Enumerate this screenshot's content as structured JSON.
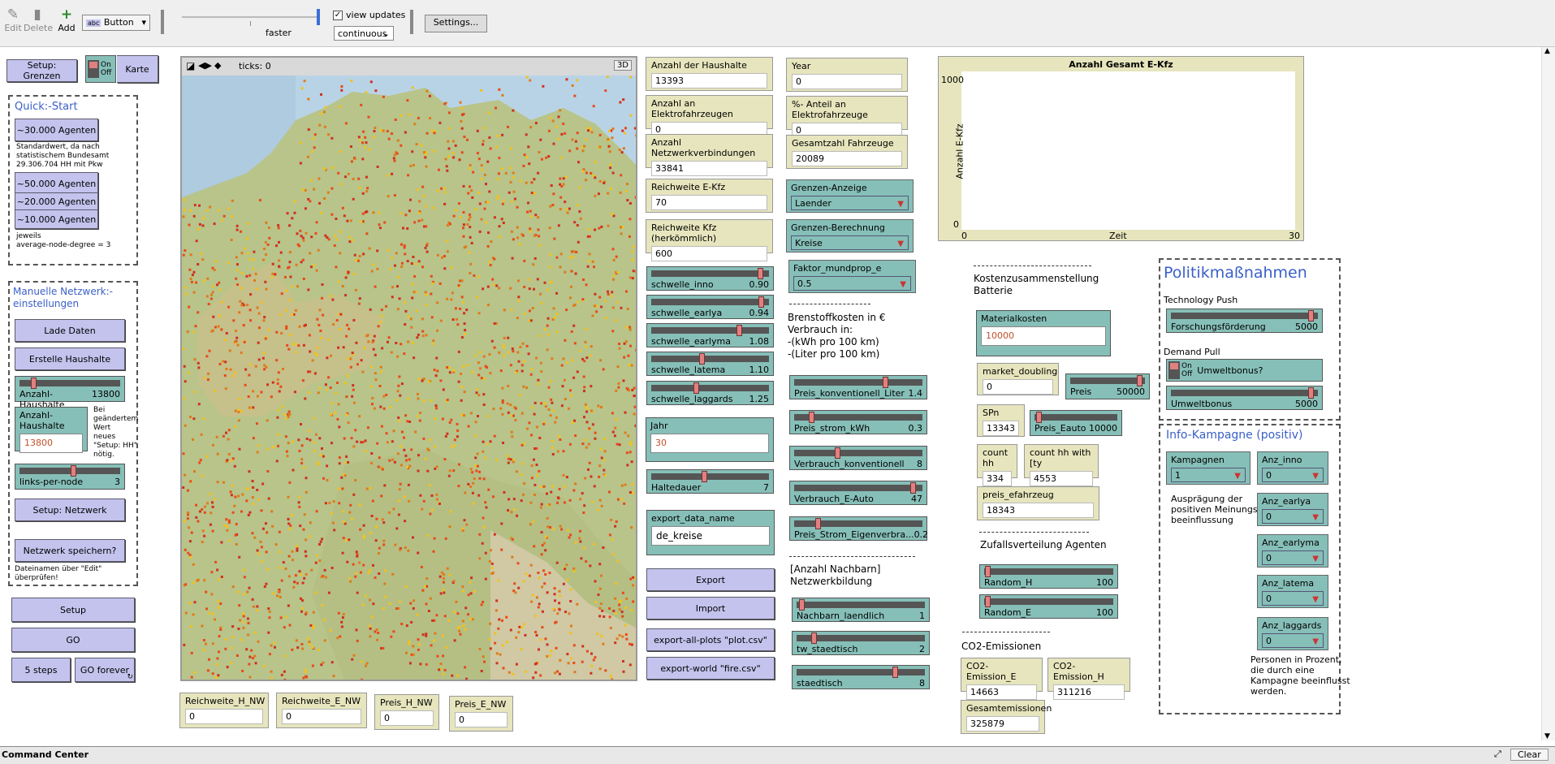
{
  "toolbar": {
    "edit": "Edit",
    "delete": "Delete",
    "add": "Add",
    "widget_type": "Button",
    "speed_label": "faster",
    "view_updates": "view updates",
    "update_mode": "continuous",
    "settings": "Settings..."
  },
  "left": {
    "setup_grenzen": "Setup: Grenzen",
    "on": "On",
    "off": "Off",
    "karte": "Karte",
    "quickstart": "Quick:-Start",
    "a30": "~30.000 Agenten",
    "a30_note1": "Standardwert, da nach",
    "a30_note2": "statistischem Bundesamt",
    "a30_note3": "29.306.704 HH mit Pkw",
    "a50": "~50.000 Agenten",
    "a20": "~20.000 Agenten",
    "a10": "~10.000 Agenten",
    "jeweils": "jeweils",
    "avgdeg": "average-node-degree = 3",
    "manuell1": "Manuelle Netzwerk:-",
    "manuell2": "einstellungen",
    "lade": "Lade Daten",
    "erstelle": "Erstelle Haushalte",
    "anzahl_hh_label": "Anzahl-Haushalte",
    "anzahl_hh_val": "13800",
    "anzahl_hh_input_label": "Anzahl-Haushalte",
    "anzahl_hh_input": "13800",
    "bei1": "Bei",
    "bei2": "geändertem",
    "bei3": "Wert",
    "bei4": "neues",
    "bei5": "\"Setup: HH\"",
    "bei6": "nötig.",
    "links_label": "links-per-node",
    "links_val": "3",
    "setup_netz": "Setup: Netzwerk",
    "speichern": "Netzwerk speichern?",
    "dateinamen1": "Dateinamen über \"Edit\"",
    "dateinamen2": "überprüfen!",
    "setup": "Setup",
    "go": "GO",
    "steps5": "5 steps",
    "goforever": "GO forever"
  },
  "map": {
    "ticks": "ticks: 0",
    "btn3d": "3D"
  },
  "bottom": [
    {
      "label": "Reichweite_H_NW",
      "value": "0"
    },
    {
      "label": "Reichweite_E_NW",
      "value": "0"
    },
    {
      "label": "Preis_H_NW",
      "value": "0"
    },
    {
      "label": "Preis_E_NW",
      "value": "0"
    }
  ],
  "col1": {
    "hh_label": "Anzahl der Haushalte",
    "hh": "13393",
    "ef_label": "Anzahl an Elektrofahrzeugen",
    "ef": "0",
    "nv_label": "Anzahl Netzwerkverbindungen",
    "nv": "33841",
    "re_label": "Reichweite E-Kfz",
    "re": "70",
    "rk_label": "Reichweite Kfz (herkömmlich)",
    "rk": "600",
    "sliders": [
      {
        "label": "schwelle_inno",
        "value": "0.90",
        "pos": 0.95
      },
      {
        "label": "schwelle_earlya",
        "value": "0.94",
        "pos": 0.96
      },
      {
        "label": "schwelle_earlyma",
        "value": "1.08",
        "pos": 0.76
      },
      {
        "label": "schwelle_latema",
        "value": "1.10",
        "pos": 0.43
      },
      {
        "label": "schwelle_laggards",
        "value": "1.25",
        "pos": 0.38
      }
    ],
    "jahr_label": "Jahr",
    "jahr": "30",
    "halte_label": "Haltedauer",
    "halte": "7",
    "halte_pos": 0.45,
    "export_name_label": "export_data_name",
    "export_name": "de_kreise",
    "export": "Export",
    "import": "Import",
    "plots": "export-all-plots \"plot.csv\"",
    "world": "export-world \"fire.csv\""
  },
  "col2": {
    "year_label": "Year",
    "year": "0",
    "pct_label": "%- Anteil an Elektrofahrzeuge",
    "pct": "0",
    "ges_label": "Gesamtzahl Fahrzeuge",
    "ges": "20089",
    "ga_label": "Grenzen-Anzeige",
    "ga": "Laender",
    "gb_label": "Grenzen-Berechnung",
    "gb": "Kreise",
    "fm_label": "Faktor_mundprop_e",
    "fm": "0.5",
    "brenn1": "Brenstoffkosten in €",
    "brenn2": "Verbrauch in:",
    "brenn3": "-(kWh pro 100 km)",
    "brenn4": "-(Liter pro 100 km)",
    "sliders": [
      {
        "label": "Preis_konventionell_Liter",
        "value": "1.4",
        "pos": 0.72
      },
      {
        "label": "Preis_strom_kWh",
        "value": "0.3",
        "pos": 0.12
      },
      {
        "label": "Verbrauch_konventionell",
        "value": "8",
        "pos": 0.33
      },
      {
        "label": "Verbrauch_E-Auto",
        "value": "47",
        "pos": 0.95
      },
      {
        "label": "Preis_Strom_Eigenverbra...",
        "value": "0.2",
        "pos": 0.17
      }
    ],
    "nach1": "[Anzahl Nachbarn]",
    "nach2": "Netzwerkbildung",
    "sliders2": [
      {
        "label": "Nachbarn_laendlich",
        "value": "1",
        "pos": 0.02
      },
      {
        "label": "tw_staedtisch",
        "value": "2",
        "pos": 0.12
      },
      {
        "label": "staedtisch",
        "value": "8",
        "pos": 0.78
      }
    ]
  },
  "plot": {
    "title": "Anzahl Gesamt E-Kfz",
    "ylabel": "Anzahl E-Kfz",
    "xlabel": "Zeit",
    "ymax": "1000",
    "ymin": "0",
    "xmin": "0",
    "xmax": "30"
  },
  "col3": {
    "kosten1": "Kostenzusammenstellung",
    "kosten2": "Batterie",
    "mat_label": "Materialkosten",
    "mat": "10000",
    "md_label": "market_doubling",
    "md": "0",
    "preis_label": "Preis",
    "preis": "50000",
    "preis_pos": 0.97,
    "spn_label": "SPn",
    "spn": "13343",
    "pe_label": "Preis_Eauto",
    "pe": "10000",
    "pe_pos": 0.02,
    "chh_label": "count hh",
    "chh": "334",
    "chhw_label": "count hh with [ty",
    "chhw": "4553",
    "pef_label": "preis_efahrzeug",
    "pef": "18343",
    "zufall": "Zufallsverteilung Agenten",
    "rh_label": "Random_H",
    "rh": "100",
    "re_label": "Random_E",
    "re": "100",
    "co2": "CO2-Emissionen",
    "ce_label": "CO2-Emission_E",
    "ce": "14663",
    "ch_label": "CO2-Emission_H",
    "ch": "311216",
    "gesamt_label": "Gesamtemissionen",
    "gesamt": "325879"
  },
  "col4": {
    "title": "Politikmaßnahmen",
    "tp": "Technology Push",
    "ff_label": "Forschungsförderung",
    "ff": "5000",
    "ff_pos": 0.97,
    "dp": "Demand Pull",
    "on": "On",
    "off": "Off",
    "ub_q": "Umweltbonus?",
    "ub_label": "Umweltbonus",
    "ub": "5000",
    "ub_pos": 0.97,
    "info": "Info-Kampagne (positiv)",
    "kamp_label": "Kampagnen",
    "kamp": "1",
    "auspr1": "Ausprägung der",
    "auspr2": "positiven Meinungs-",
    "auspr3": "beeinflussung",
    "anz": [
      {
        "label": "Anz_inno",
        "value": "0"
      },
      {
        "label": "Anz_earlya",
        "value": "0"
      },
      {
        "label": "Anz_earlyma",
        "value": "0"
      },
      {
        "label": "Anz_latema",
        "value": "0"
      },
      {
        "label": "Anz_laggards",
        "value": "0"
      }
    ],
    "pers1": "Personen in Prozent,",
    "pers2": "die durch eine",
    "pers3": "Kampagne beeinflusst",
    "pers4": "werden."
  },
  "cmd": {
    "title": "Command Center",
    "clear": "Clear"
  }
}
